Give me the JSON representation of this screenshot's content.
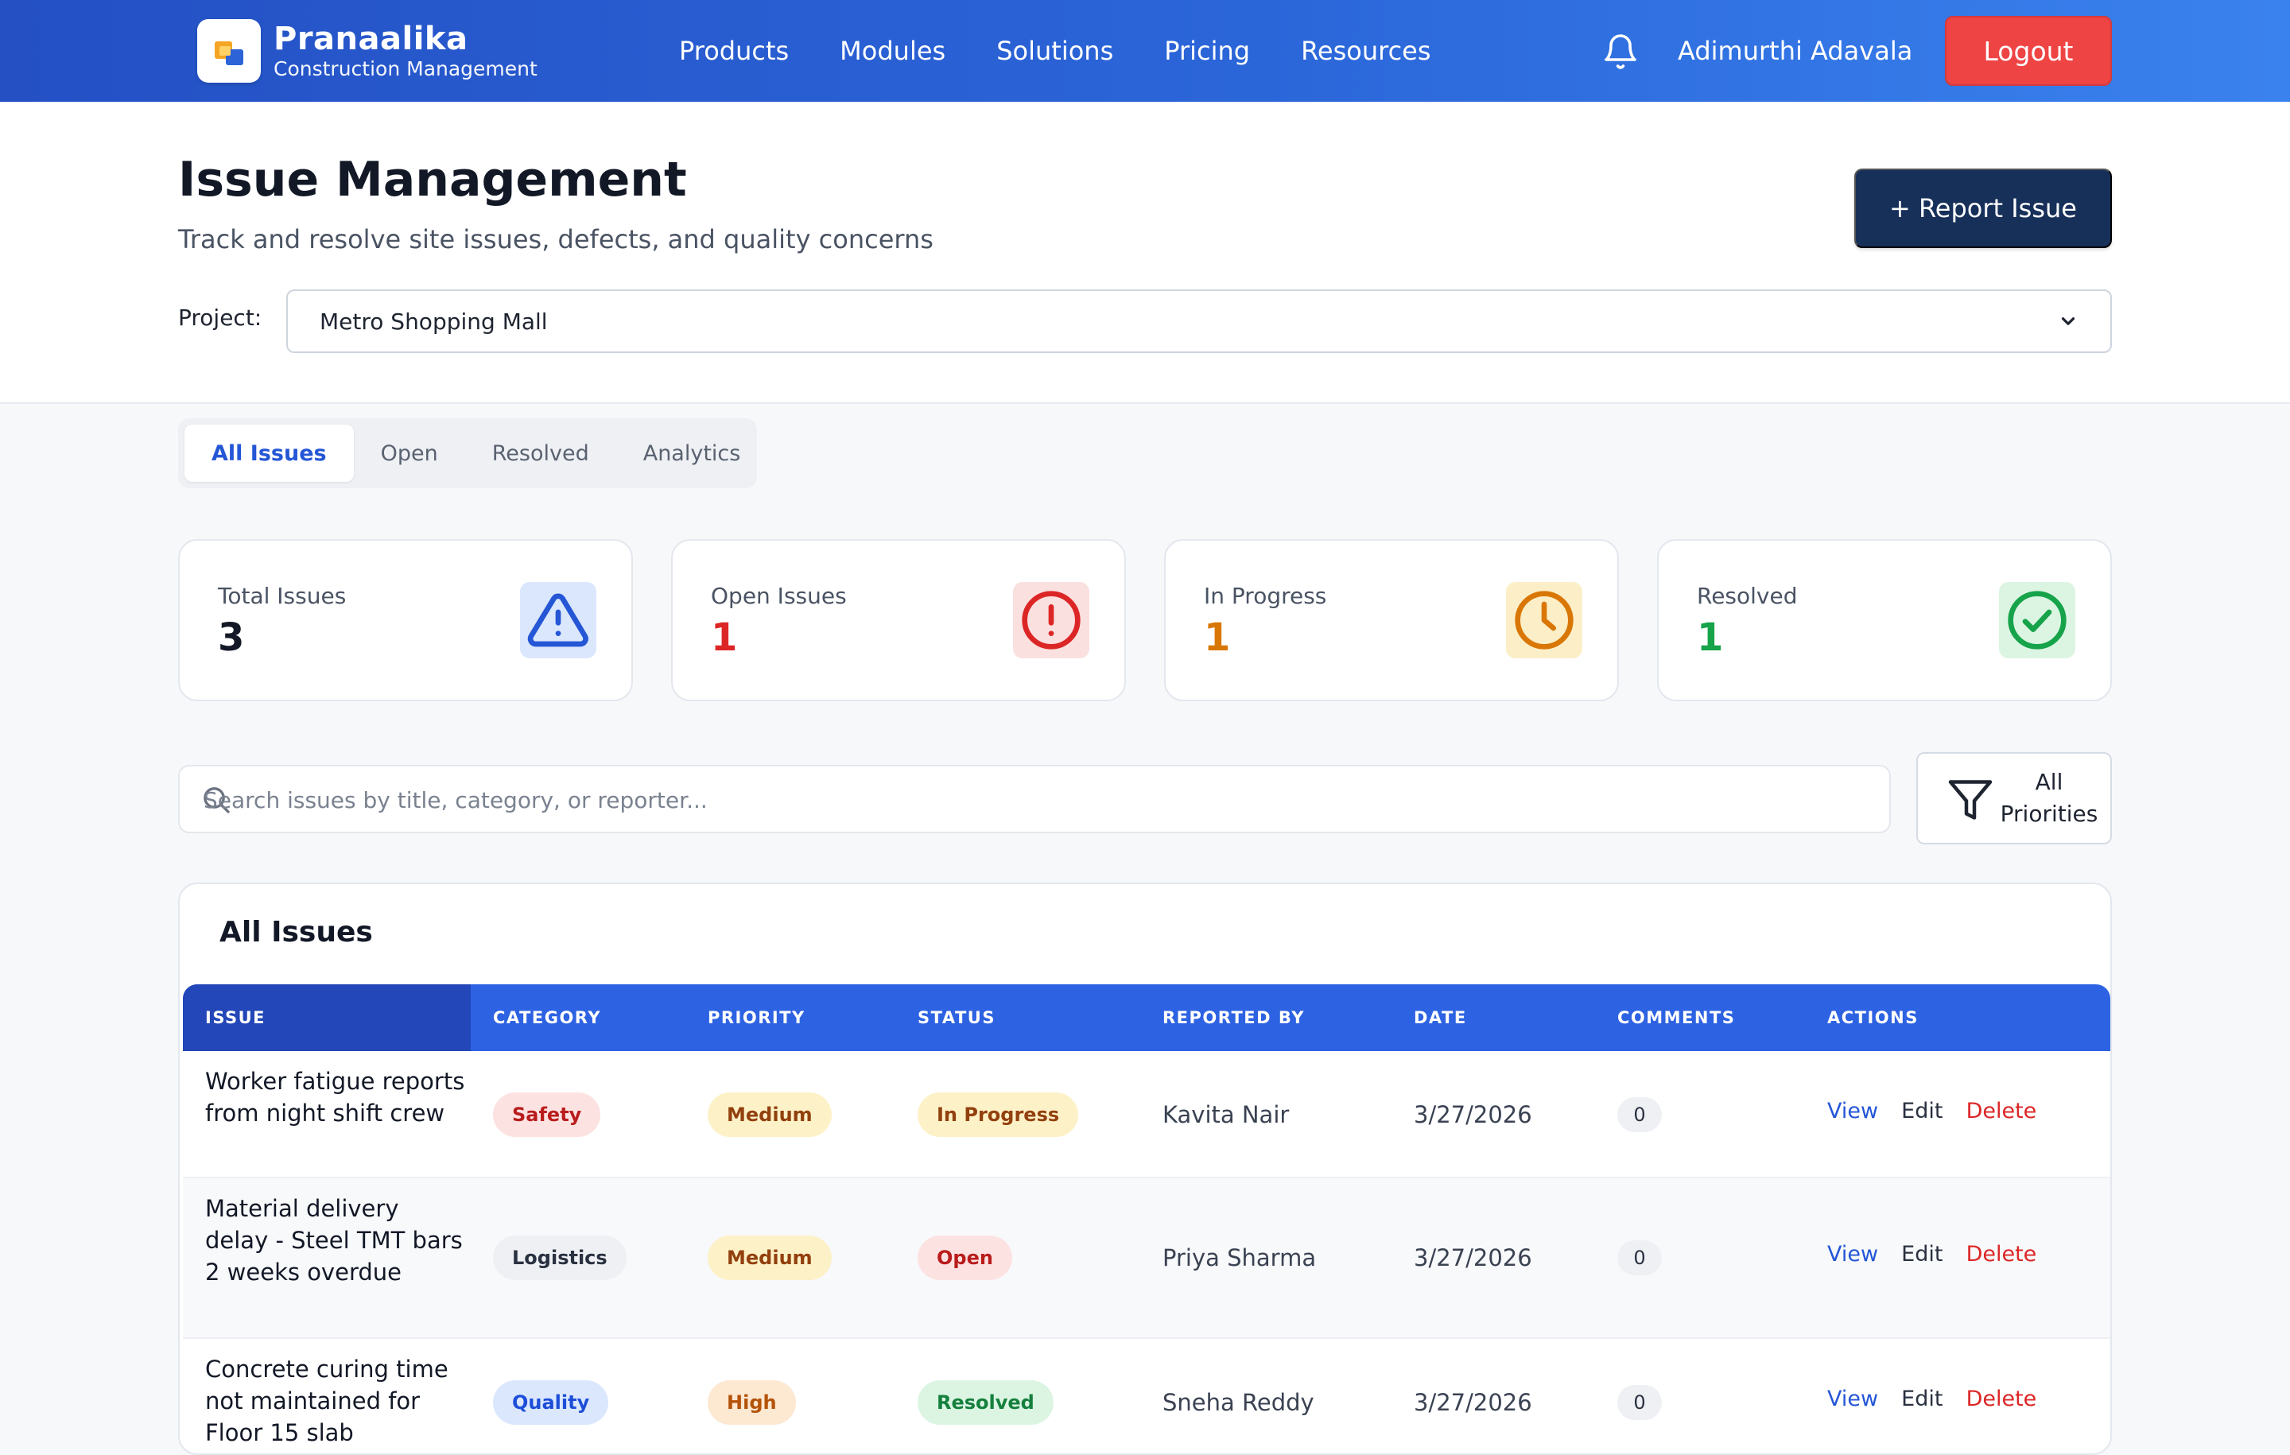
{
  "brand": {
    "name": "Pranaalika",
    "subtitle": "Construction Management"
  },
  "nav": {
    "links": [
      "Products",
      "Modules",
      "Solutions",
      "Pricing",
      "Resources"
    ]
  },
  "user": {
    "name": "Adimurthi Adavala",
    "logout_label": "Logout"
  },
  "header": {
    "title": "Issue Management",
    "subtitle": "Track and resolve site issues, defects, and quality concerns",
    "report_label": "+ Report Issue",
    "project_label": "Project:",
    "project_value": "Metro Shopping Mall"
  },
  "tabs": [
    {
      "label": "All Issues",
      "active": true
    },
    {
      "label": "Open",
      "active": false
    },
    {
      "label": "Resolved",
      "active": false
    },
    {
      "label": "Analytics",
      "active": false
    }
  ],
  "stats": [
    {
      "label": "Total Issues",
      "value": "3",
      "color": "#121826",
      "icon": "warning-triangle-icon"
    },
    {
      "label": "Open Issues",
      "value": "1",
      "color": "#dc2626",
      "icon": "alert-circle-icon"
    },
    {
      "label": "In Progress",
      "value": "1",
      "color": "#d97706",
      "icon": "clock-icon"
    },
    {
      "label": "Resolved",
      "value": "1",
      "color": "#16a34a",
      "icon": "check-circle-icon"
    }
  ],
  "search": {
    "placeholder": "Search issues by title, category, or reporter..."
  },
  "filter": {
    "label": "All Priorities"
  },
  "table": {
    "title": "All Issues",
    "columns": [
      "ISSUE",
      "CATEGORY",
      "PRIORITY",
      "STATUS",
      "REPORTED BY",
      "DATE",
      "COMMENTS",
      "ACTIONS"
    ],
    "rows": [
      {
        "issue": "Worker fatigue reports from night shift crew",
        "category": "Safety",
        "priority": "Medium",
        "status": "In Progress",
        "reported_by": "Kavita Nair",
        "date": "3/27/2026",
        "comments": "0"
      },
      {
        "issue": "Material delivery delay - Steel TMT bars 2 weeks overdue",
        "category": "Logistics",
        "priority": "Medium",
        "status": "Open",
        "reported_by": "Priya Sharma",
        "date": "3/27/2026",
        "comments": "0"
      },
      {
        "issue": "Concrete curing time not maintained for Floor 15 slab",
        "category": "Quality",
        "priority": "High",
        "status": "Resolved",
        "reported_by": "Sneha Reddy",
        "date": "3/27/2026",
        "comments": "0"
      }
    ],
    "actions": {
      "view": "View",
      "edit": "Edit",
      "delete": "Delete"
    }
  },
  "colors": {
    "nav_start": "#2450c4",
    "nav_end": "#3a82ee",
    "logout": "#ef4444",
    "report": "#17305a",
    "accent": "#2456d6"
  }
}
